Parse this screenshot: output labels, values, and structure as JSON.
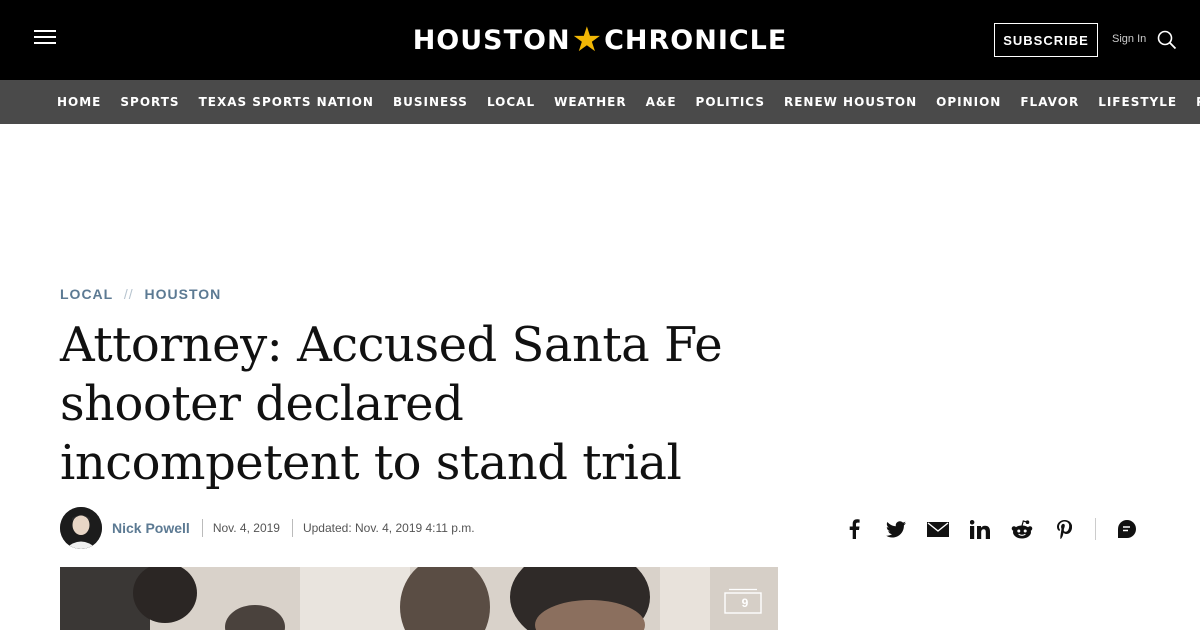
{
  "header": {
    "logo_left": "HOUSTON",
    "logo_star": "★",
    "logo_right": "CHRONICLE",
    "subscribe_label": "SUBSCRIBE",
    "signin_label": "Sign In"
  },
  "nav": {
    "items": [
      "HOME",
      "SPORTS",
      "TEXAS SPORTS NATION",
      "BUSINESS",
      "LOCAL",
      "WEATHER",
      "A&E",
      "POLITICS",
      "RENEW HOUSTON",
      "OPINION",
      "FLAVOR",
      "LIFESTYLE",
      "PODCASTS"
    ]
  },
  "article": {
    "breadcrumb": {
      "section": "LOCAL",
      "separator": "//",
      "subsection": "HOUSTON"
    },
    "headline": "Attorney: Accused Santa Fe shooter declared incompetent to stand trial",
    "byline": {
      "author": "Nick Powell",
      "published": "Nov. 4, 2019",
      "updated": "Updated: Nov. 4, 2019 4:11 p.m."
    },
    "share_icons": [
      "facebook-icon",
      "twitter-icon",
      "email-icon",
      "linkedin-icon",
      "reddit-icon",
      "pinterest-icon",
      "comment-icon"
    ],
    "gallery_count": "9"
  },
  "colors": {
    "topbar": "#000000",
    "navbar": "#4a4a4a",
    "accent_star": "#f2b705",
    "breadcrumb": "#5c7a93"
  }
}
